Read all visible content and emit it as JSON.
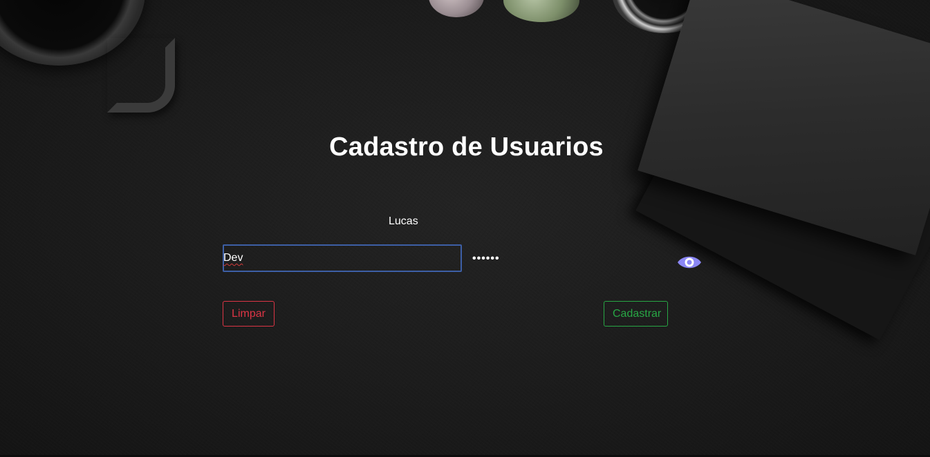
{
  "page": {
    "title": "Cadastro de Usuarios"
  },
  "form": {
    "name_value": "Lucas",
    "job_value": "Dev",
    "password_masked": "••••••",
    "clear_label": "Limpar",
    "submit_label": "Cadastrar"
  },
  "icons": {
    "password_toggle": "eye-icon"
  },
  "colors": {
    "clear_button": "#dc3545",
    "submit_button": "#28a745",
    "focus_border": "#3d5fa6",
    "eye_icon": "#8b87f5"
  }
}
